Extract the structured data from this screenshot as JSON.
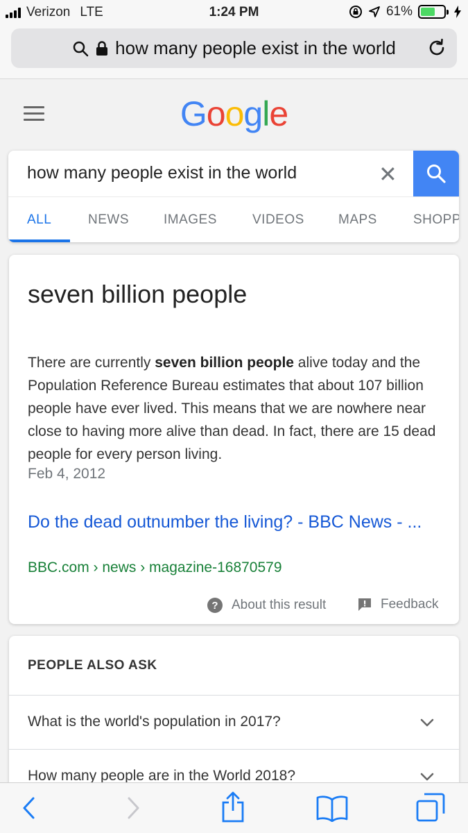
{
  "status_bar": {
    "carrier": "Verizon",
    "network": "LTE",
    "time": "1:24 PM",
    "battery_percent": "61%",
    "battery_level": 0.61
  },
  "browser": {
    "url_text": "how many people exist in the world"
  },
  "google": {
    "logo_letters": [
      {
        "char": "G",
        "color": "#4285f4"
      },
      {
        "char": "o",
        "color": "#ea4335"
      },
      {
        "char": "o",
        "color": "#fbbc05"
      },
      {
        "char": "g",
        "color": "#4285f4"
      },
      {
        "char": "l",
        "color": "#34a853"
      },
      {
        "char": "e",
        "color": "#ea4335"
      }
    ],
    "search_query": "how many people exist in the world",
    "tabs": [
      "ALL",
      "NEWS",
      "IMAGES",
      "VIDEOS",
      "MAPS",
      "SHOPP"
    ]
  },
  "answer": {
    "title": "seven billion people",
    "body_pre": "There are currently ",
    "body_bold": "seven billion people",
    "body_post": " alive today and the Population Reference Bureau estimates that about 107 billion people have ever lived. This means that we are nowhere near close to having more alive than dead. In fact, there are 15 dead people for every person living.",
    "date": "Feb 4, 2012",
    "source_title": "Do the dead outnumber the living? - BBC News - ...",
    "source_cite": "BBC.com › news › magazine-16870579",
    "about_label": "About this result",
    "feedback_label": "Feedback"
  },
  "people_also_ask": {
    "heading": "PEOPLE ALSO ASK",
    "questions": [
      "What is the world's population in 2017?",
      "How many people are in the World 2018?"
    ]
  },
  "colors": {
    "accent_blue": "#1a73e8",
    "link_blue": "#1558d6",
    "cite_green": "#188038",
    "search_button": "#4285f4",
    "battery_green": "#4cd964"
  }
}
